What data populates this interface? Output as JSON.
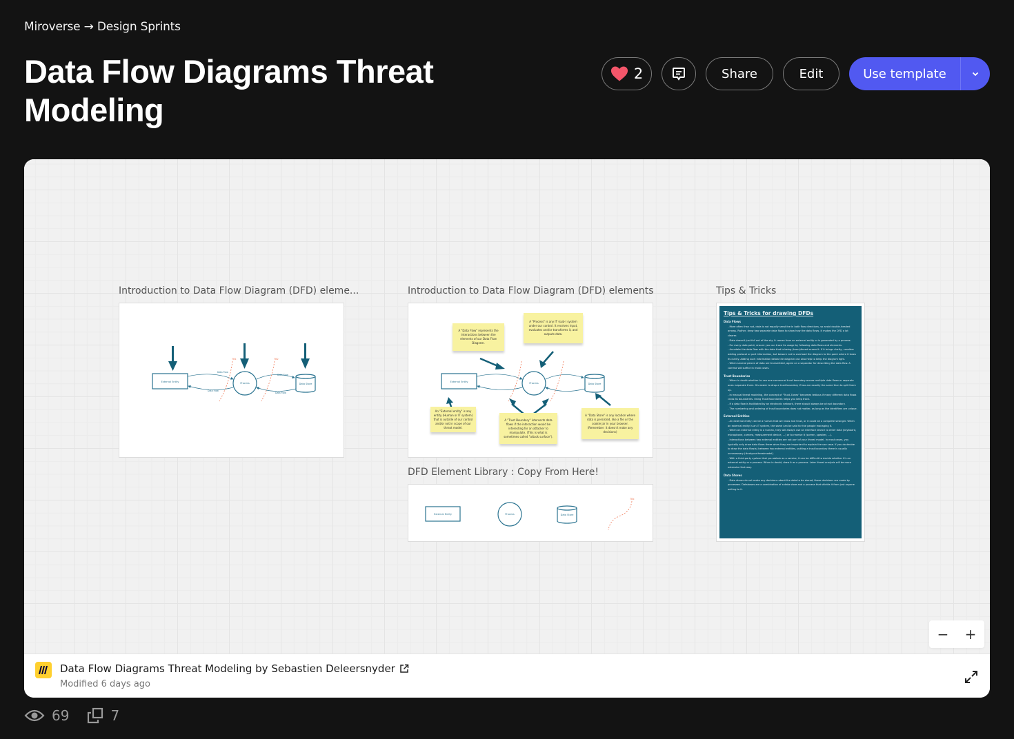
{
  "breadcrumb": {
    "parent": "Miroverse",
    "separator": "→",
    "current": "Design Sprints"
  },
  "title": "Data Flow Diagrams Threat Modeling",
  "actions": {
    "like_count": "2",
    "like_icon": "heart-icon",
    "comment_icon": "comment-icon",
    "share_label": "Share",
    "edit_label": "Edit",
    "use_template_label": "Use template",
    "dropdown_icon": "chevron-down-icon"
  },
  "colors": {
    "accent": "#5159f1",
    "heart": "#f4566a",
    "dfd_teal": "#145f77",
    "trust_boundary": "#f07c5a",
    "sticky": "#f8f2a0"
  },
  "board": {
    "frames": [
      {
        "title": "Introduction to Data Flow Diagram (DFD) eleme...",
        "diagram": {
          "external_entity": "External Entity",
          "process": "Process",
          "data_store": "Data Store",
          "flow_label": "Data Flow",
          "tb1": "TB1",
          "tb2": "TB2"
        }
      },
      {
        "title": "Introduction to Data Flow Diagram (DFD) elements",
        "stickies": [
          "A \"Data Flow\" represents the interactions between the elements of our Data Flow Diagram.",
          "A \"Process\" is any IT (sub-) system under our control. It receives input, evaluates and/or transforms it, and outputs data.",
          "An \"External entity\" is any entity (Human or IT system) that is outside of our control and/or not in scope of our threat model.",
          "A \"Trust Boundary\" intersects data flows if the interaction would be interesting for an attacker to manipulate. (This is what is sometimes called \"attack surface\").",
          "A \"Data Store\" is any location where data is persisted, like a file or the cookie jar in your browser. (Remember: it doesn't make any decisions)"
        ]
      },
      {
        "title": "DFD Element Library : Copy From Here!",
        "library": {
          "external_entity": "External Entity",
          "process": "Process",
          "data_store": "Data Store",
          "tb": "TBx"
        }
      },
      {
        "title": "Tips & Tricks",
        "heading": "Tips & Tricks for drawing DFDs",
        "sections": [
          {
            "name": "Data Flows",
            "items": [
              "More often than not, data is not equally sensitive in both flow directions, so avoid double-headed arrows. Rather, draw two separate data flows to show how the data flows. It makes the DFD a lot clearer.",
              "Data doesn't just fall out of the sky. It comes from an external entity or is generated by a process.",
              "For every data point, ensure you can trace its usage by following data flows and elements.",
              "Annotate the data flow with the data that is being (trans)ferred across it. If it brings clarity, consider adding protocol or port information, but beware not to overload the diagram to the point where it loses its clarity. Adding such information below the diagram can also help to keep the diagram light.",
              "When several pieces of data are transmitted, agree on a separator for describing the data flow. A comma will suffice in most cases."
            ]
          },
          {
            "name": "Trust Boundaries",
            "items": [
              "When in doubt whether to use one communal trust boundary across multiple data flows or separate ones: separate them. It's easier to drop a trust boundary if two are exactly the same than to split them up.",
              "In manual threat modeling, the concept of \"Trust Zones\" becomes tedious if many different data flows cross its boundaries. Using Trust Boundaries helps you keep track.",
              "If a data flow is facilitated by an electronic network, there should always be a trust boundary.",
              "The numbering and ordering of trust boundaries does not matter, as long as the identifiers are unique."
            ]
          },
          {
            "name": "External Entities",
            "items": [
              "An external entity can be a human that we know and trust, or it could be a complete stranger. When an external entity is an IT system, the same can be said for the people managing it.",
              "When an external entity is a human, they will always use an interface device to enter data (keyboard, microphone, camera, measurement device, ...) or to receive it (screen, speaker, ...).",
              "Interactions between two external entities are not part of your threat model. In most cases, you typically only draw data flows there when they are important to explain the use case. If you do decide to draw the data flow(s) between two external entities, putting a trust boundary there is usually unnecessary (#notyourthreatmodel).",
              "With a third-party system that you obtain as a service, it can be difficult to decide whether it's an external entity or a process. When in doubt, draw it as a process. Later threat analysis will be more extensive that way."
            ]
          },
          {
            "name": "Data Stores",
            "items": [
              "Data stores do not make any decisions about the data to be stored; those decisions are made by processes. Databases are a combination of a data store and a process that shields it from just anyone writing to it."
            ]
          }
        ]
      }
    ],
    "zoom_out": "−",
    "zoom_in": "+"
  },
  "footer": {
    "board_title": "Data Flow Diagrams Threat Modeling by Sebastien Deleersnyder",
    "modified": "Modified 6 days ago",
    "external_link_icon": "external-link-icon",
    "fullscreen_icon": "fullscreen-icon"
  },
  "stats": {
    "views": "69",
    "copies": "7"
  }
}
